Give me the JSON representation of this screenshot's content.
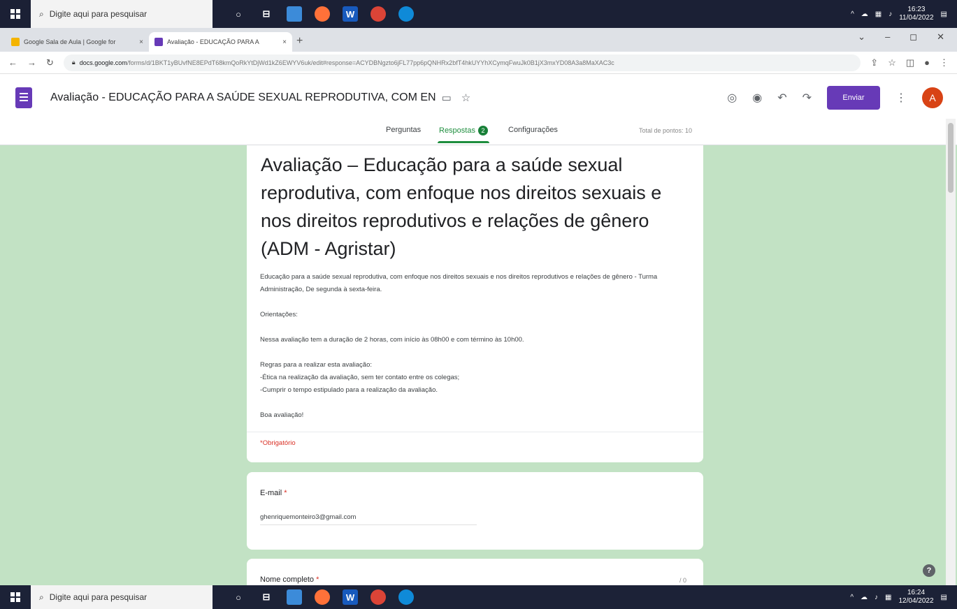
{
  "taskbar": {
    "search_placeholder": "Digite aqui para pesquisar",
    "top_time": "16:23",
    "top_date": "11/04/2022",
    "bottom_time": "16:24",
    "bottom_date": "12/04/2022"
  },
  "browser": {
    "tabs": [
      {
        "label": "Google Sala de Aula | Google for",
        "close": "×"
      },
      {
        "label": "Avaliação - EDUCAÇÃO PARA A",
        "close": "×"
      }
    ],
    "new_tab": "+",
    "url_domain": "docs.google.com",
    "url_path": "/forms/d/1BKT1yBUvfNE8EPdT68kmQoRkYtDjWd1kZ6EWYV6uk/edit#response=ACYDBNgzto6jFL77pp6pQNHRx2bfT4hkUYYhXCymqFwuJk0B1jX3mxYD08A3a8MaXAC3c",
    "window_controls": [
      "⌄",
      "–",
      "◻",
      "✕"
    ]
  },
  "forms_header": {
    "title": "Avaliação - EDUCAÇÃO PARA A SAÚDE SEXUAL REPRODUTIVA, COM EN",
    "send_label": "Enviar",
    "avatar_initial": "A",
    "tabs": {
      "questions": "Perguntas",
      "responses": "Respostas",
      "responses_count": "2",
      "settings": "Configurações"
    },
    "total_points": "Total de pontos: 10"
  },
  "form": {
    "title": "Avaliação – Educação para a saúde sexual reprodutiva, com enfoque nos direitos sexuais e nos direitos reprodutivos e relações de gênero (ADM - Agristar)",
    "description": {
      "intro": "Educação para a saúde sexual reprodutiva, com enfoque nos direitos sexuais e nos direitos reprodutivos e relações de gênero  - Turma Administração, De segunda à sexta-feira.",
      "orientations_label": "Orientações:",
      "duration": "Nessa avaliação tem a duração de  2 horas, com início às 08h00 e com término às 10h00.",
      "rules_title": "Regras para a realizar esta avaliação:",
      "rule_1": "-Ética na realização da avaliação, sem ter contato entre os colegas;",
      "rule_2": "-Cumprir o tempo estipulado para a realização da avaliação.",
      "closing": "Boa avaliação!"
    },
    "required_note": "*Obrigatório",
    "email": {
      "label": "E-mail",
      "required_mark": "*",
      "value": "ghenriquemonteiro3@gmail.com"
    },
    "name_question": {
      "label": "Nome completo",
      "required_mark": "*",
      "points": "/ 0"
    }
  },
  "help_icon": "?",
  "colors": {
    "accent": "#673ab7",
    "theme_background": "#c2e2c4",
    "responses_green": "#1e8e3e",
    "required_red": "#d93025"
  }
}
